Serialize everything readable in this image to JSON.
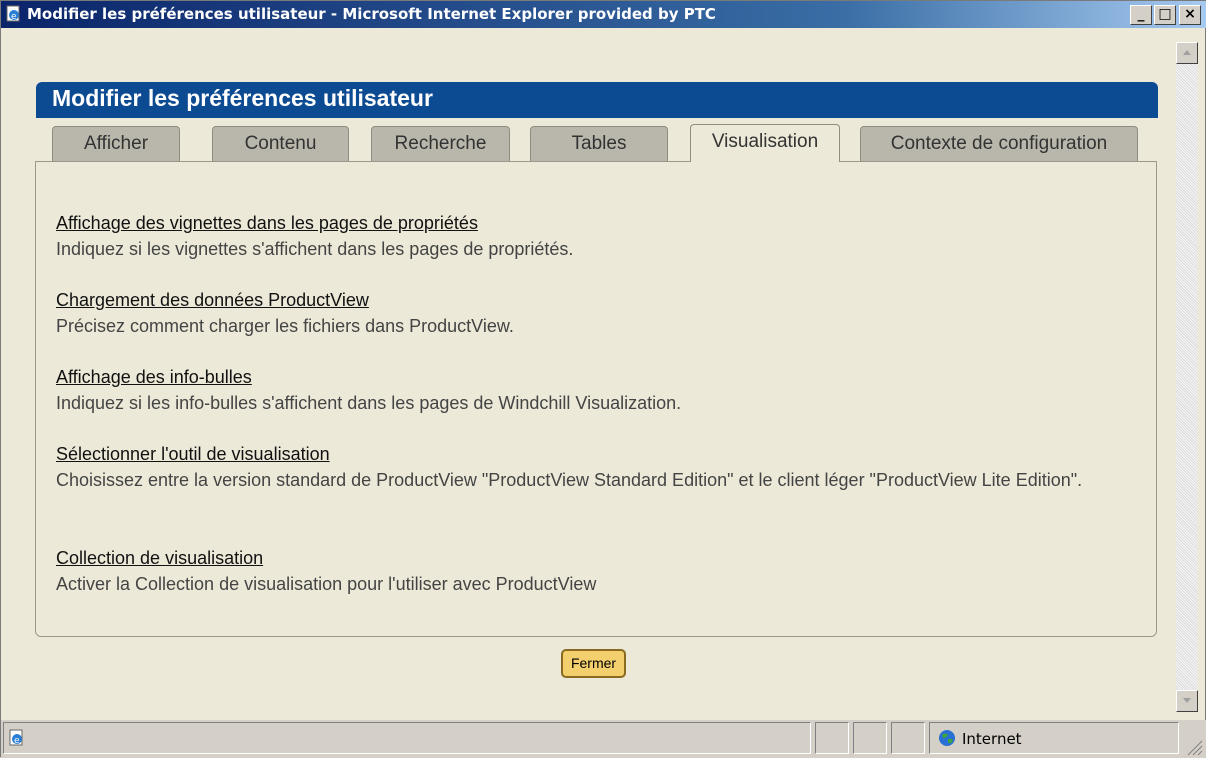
{
  "window": {
    "title": "Modifier les préférences utilisateur - Microsoft Internet Explorer provided by PTC",
    "minimize": "_",
    "maximize": "□",
    "close": "×"
  },
  "page": {
    "heading": "Modifier les préférences utilisateur",
    "tabs": [
      {
        "label": "Afficher"
      },
      {
        "label": "Contenu"
      },
      {
        "label": "Recherche"
      },
      {
        "label": "Tables"
      },
      {
        "label": "Visualisation"
      },
      {
        "label": "Contexte de configuration"
      }
    ],
    "active_tab": "Visualisation",
    "sections": [
      {
        "title": "Affichage des vignettes dans les pages de propriétés",
        "desc": "Indiquez si les vignettes s'affichent dans les pages de propriétés."
      },
      {
        "title": "Chargement des données ProductView",
        "desc": "Précisez comment charger les fichiers dans ProductView."
      },
      {
        "title": "Affichage des info-bulles",
        "desc": "Indiquez si les info-bulles s'affichent dans les pages de Windchill Visualization."
      },
      {
        "title": "Sélectionner l'outil de visualisation",
        "desc": "Choisissez entre la version standard de ProductView \"ProductView Standard Edition\" et le client léger \"ProductView Lite Edition\"."
      },
      {
        "title": "Collection de visualisation",
        "desc": "Activer la Collection de visualisation pour l'utiliser avec ProductView"
      }
    ],
    "close_button": "Fermer"
  },
  "statusbar": {
    "zone": "Internet"
  },
  "colors": {
    "header": "#0c4a91",
    "button": "#f3d06d"
  }
}
